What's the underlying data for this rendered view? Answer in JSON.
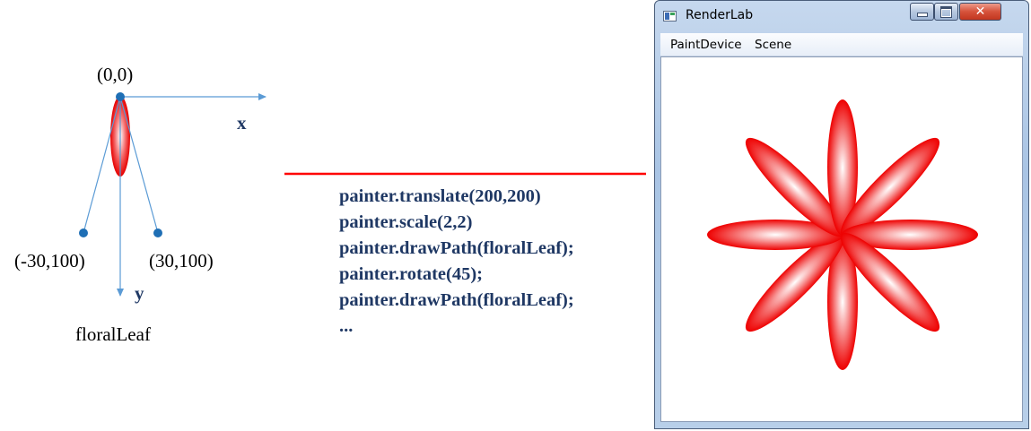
{
  "diagram": {
    "origin_label": "(0,0)",
    "x_axis_label": "x",
    "y_axis_label": "y",
    "left_point_label": "(-30,100)",
    "right_point_label": "(30,100)",
    "shape_name": "floralLeaf"
  },
  "code_lines": [
    "painter.translate(200,200)",
    "painter.scale(2,2)",
    "painter.drawPath(floralLeaf);",
    "painter.rotate(45);",
    "painter.drawPath(floralLeaf);",
    "..."
  ],
  "window": {
    "title": "RenderLab",
    "menu": [
      "PaintDevice",
      "Scene"
    ],
    "close_glyph": "✕"
  },
  "scene": {
    "petal_count": 8,
    "rotation_step_deg": 45,
    "petal_color": "#ff0000",
    "petal_highlight": "#ffffff"
  },
  "colors": {
    "arrow": "#ff0000",
    "axes": "#5b9bd5",
    "points": "#1f6fb5",
    "code_text": "#1f3864"
  }
}
